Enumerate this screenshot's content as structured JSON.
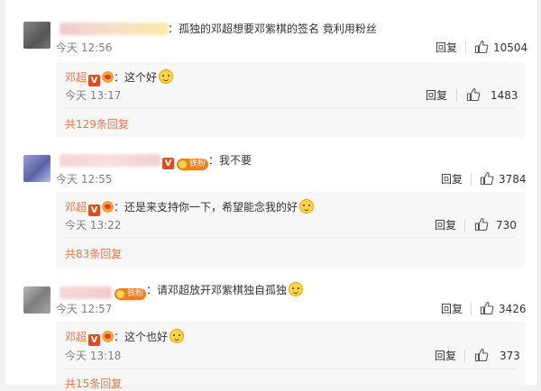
{
  "comments": [
    {
      "text": "：孤独的邓超想要邓紫棋的签名 竟利用粉丝",
      "time": "今天 12:56",
      "reply": "回复",
      "likes": "10504",
      "sub_reply": {
        "author": "邓超",
        "text": "：这个好",
        "time": "今天 13:17",
        "reply": "回复",
        "likes": "1483"
      },
      "more": "共129条回复"
    },
    {
      "text": "：我不要",
      "time": "今天 12:55",
      "reply": "回复",
      "likes": "3784",
      "fan_badge": "铁粉",
      "sub_reply": {
        "author": "邓超",
        "text": "：还是来支持你一下，希望能念我的好",
        "time": "今天 13:22",
        "reply": "回复",
        "likes": "730"
      },
      "more": "共83条回复"
    },
    {
      "text": "：请邓超放开邓紫棋独自孤独",
      "time": "今天 12:57",
      "reply": "回复",
      "likes": "3426",
      "fan_badge": "铁粉",
      "sub_reply": {
        "author": "邓超",
        "text": "：这个也好",
        "time": "今天 13:18",
        "reply": "回复",
        "likes": "373"
      },
      "more": "共15条回复"
    }
  ],
  "icons": {
    "like": "thumbs-up-icon",
    "verified": "verified-v-icon",
    "member": "member-heart-icon",
    "emoji": "doge-emoji-icon"
  },
  "colors": {
    "accent": "#eb7350",
    "meta": "#808080",
    "sub_bg": "#f7f7f7"
  }
}
